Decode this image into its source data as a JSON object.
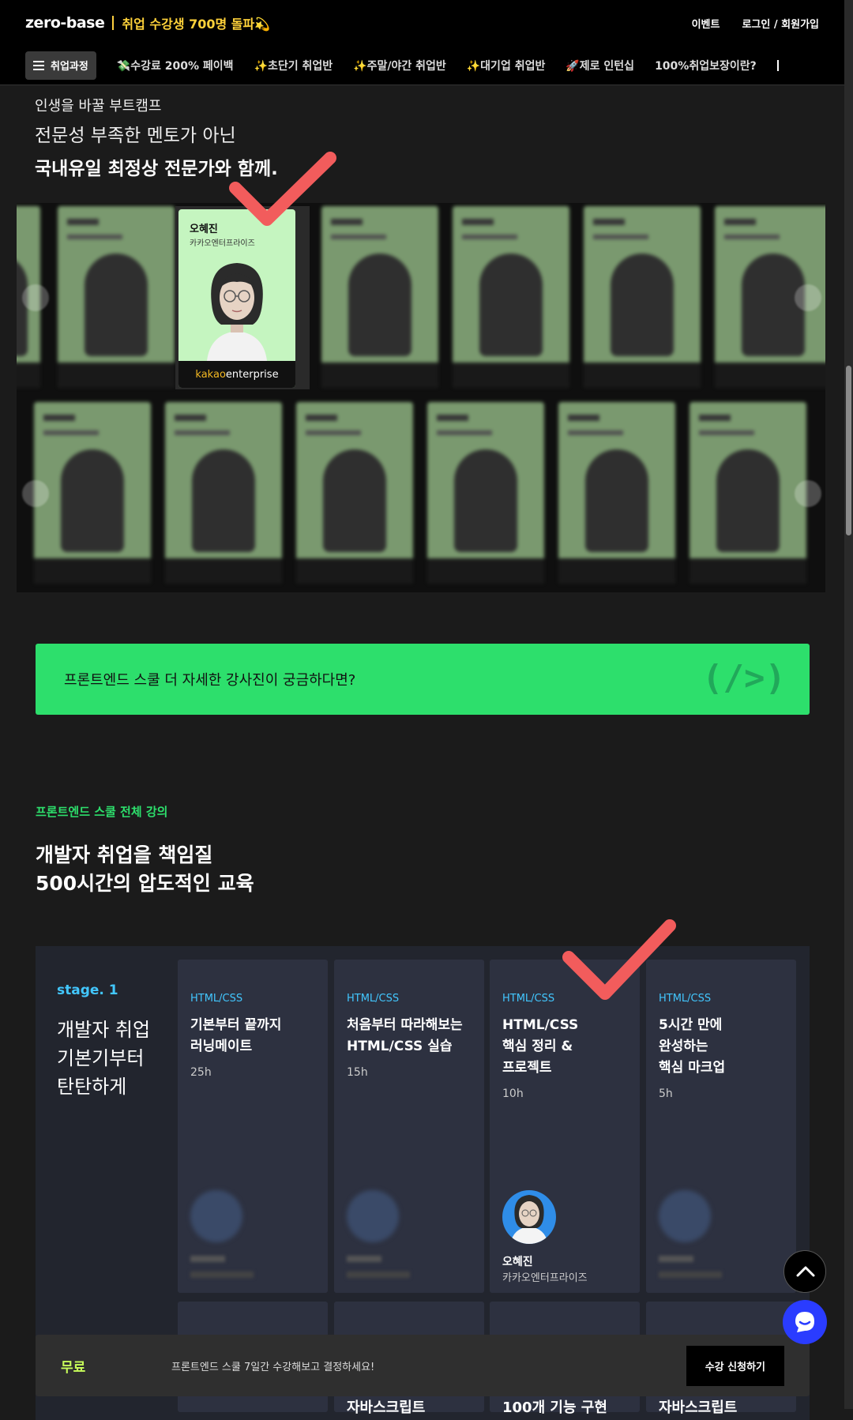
{
  "header": {
    "brand": "zero-base",
    "tagline": "취업 수강생 700명 돌파💫",
    "links": [
      "이벤트",
      "로그인 / 회원가입"
    ]
  },
  "nav": {
    "menu_label": "취업과정",
    "items": [
      "💸수강료 200% 페이백",
      "✨초단기 취업반",
      "✨주말/야간 취업반",
      "✨대기업 취업반",
      "🚀제로 인턴십",
      "100%취업보장이란?"
    ]
  },
  "intro": {
    "line1": "인생을 바꿀 부트캠프",
    "line2": "전문성 부족한 멘토가 아닌",
    "line3": "국내유일 최정상 전문가와 함께."
  },
  "featured_mentor": {
    "name": "오혜진",
    "company": "카카오엔터프라이즈",
    "logo_a": "kakao",
    "logo_b": "enterprise"
  },
  "banner": {
    "text": "프론트엔드 스쿨 더 자세한 강사진이 궁금하다면?",
    "logo": "(/>)"
  },
  "section": {
    "tag": "프론트엔드 스쿨 전체 강의",
    "title_line1": "개발자 취업을 책임질",
    "title_line2": "500시간의 압도적인 교육"
  },
  "stage": {
    "label": "stage. 1",
    "desc_line1": "개발자 취업",
    "desc_line2": "기본기부터",
    "desc_line3": "탄탄하게"
  },
  "courses": [
    {
      "category": "HTML/CSS",
      "title_lines": [
        "기본부터 끝까지",
        "러닝메이트"
      ],
      "duration": "25h"
    },
    {
      "category": "HTML/CSS",
      "title_lines": [
        "처음부터 따라해보는",
        "HTML/CSS 실습"
      ],
      "duration": "15h"
    },
    {
      "category": "HTML/CSS",
      "title_lines": [
        "HTML/CSS",
        "핵심 정리 &",
        "프로젝트"
      ],
      "duration": "10h",
      "instructor": "오혜진",
      "instructor_company": "카카오엔터프라이즈"
    },
    {
      "category": "HTML/CSS",
      "title_lines": [
        "5시간 만에",
        "완성하는",
        "핵심 마크업"
      ],
      "duration": "5h"
    }
  ],
  "lower_courses": [
    "자바스크립트",
    "100개 기능 구현",
    "자바스크립트"
  ],
  "bottom_bar": {
    "free": "무료",
    "message": "프론트엔드 스쿨 7일간 수강해보고 결정하세요!",
    "apply": "수강 신청하기"
  },
  "colors": {
    "accent_green": "#2ddf6c",
    "check_red": "#f25c5c",
    "stage_blue": "#42c7ff",
    "tag_yellow": "#ffd23a"
  }
}
